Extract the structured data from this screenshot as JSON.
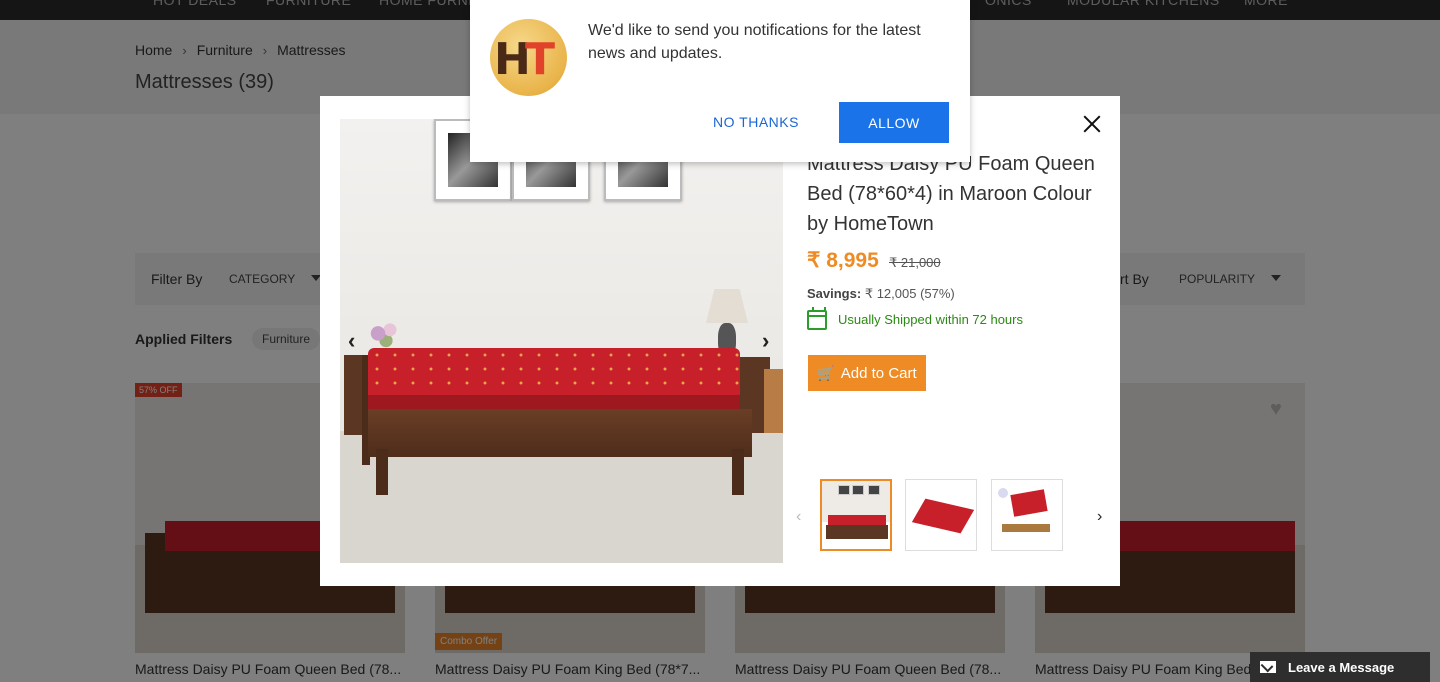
{
  "topnav": {
    "items": [
      "HOT DEALS",
      "FURNITURE",
      "HOME FURNI",
      "ONICS",
      "MODULAR KITCHENS",
      "MORE"
    ]
  },
  "breadcrumb": [
    "Home",
    "Furniture",
    "Mattresses"
  ],
  "page_title": "Mattresses (39)",
  "filter_bar": {
    "filter_by": "Filter By",
    "category": "CATEGORY",
    "sort_by": "rt By",
    "sort_value": "POPULARITY"
  },
  "applied_filters": {
    "label": "Applied Filters",
    "chip": "Furniture"
  },
  "products": [
    {
      "name": "Mattress Daisy PU Foam Queen Bed (78...",
      "badge": "57% OFF"
    },
    {
      "name": "Mattress Daisy PU Foam King Bed (78*7...",
      "badge": "Combo Offer"
    },
    {
      "name": "Mattress Daisy PU Foam Queen Bed (78..."
    },
    {
      "name": "Mattress Daisy PU Foam King Bed (78..."
    }
  ],
  "modal": {
    "title": "Mattress Daisy PU Foam Queen Bed (78*60*4) in Maroon Colour by HomeTown",
    "price": "₹ 8,995",
    "mrp": "₹ 21,000",
    "savings_label": "Savings:",
    "savings_value": "₹ 12,005 (57%)",
    "shipping": "Usually Shipped within 72 hours",
    "add_to_cart": "Add to Cart"
  },
  "notification": {
    "logo_text_h": "H",
    "logo_text_t": "T",
    "message": "We'd like to send you notifications for the latest news and updates.",
    "no_thanks": "NO THANKS",
    "allow": "ALLOW"
  },
  "chat": {
    "label": "Leave a Message"
  },
  "colors": {
    "accent": "#ef8b24",
    "allow_button": "#1a73e8",
    "ship_green": "#2a8a12",
    "mattress_red": "#c8202a"
  }
}
